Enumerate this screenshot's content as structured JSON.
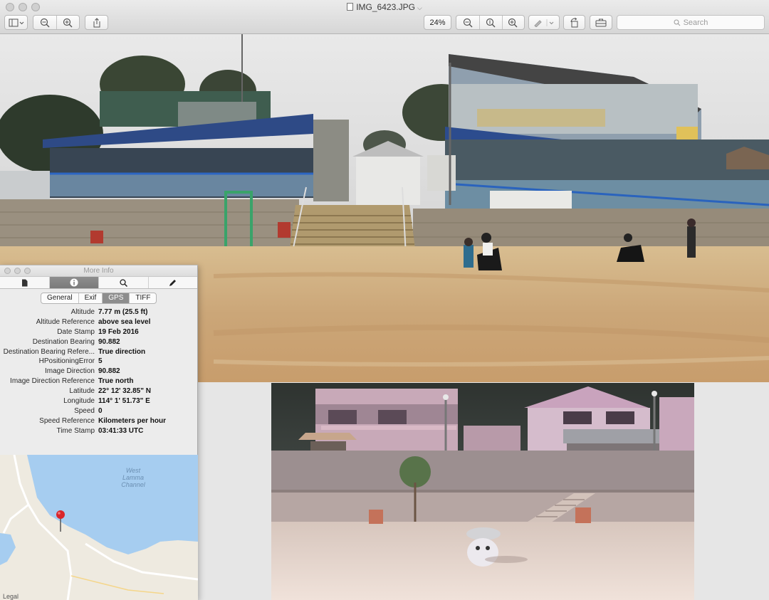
{
  "window": {
    "file_name": "IMG_6423.JPG",
    "zoom": "24%",
    "search_placeholder": "Search"
  },
  "toolbar_icons": [
    "sidebar-icon",
    "zoom-out-icon",
    "zoom-in-icon",
    "share-icon",
    "zoom-out-icon",
    "actual-size-icon",
    "zoom-in-icon",
    "markup-pen-icon",
    "rotate-icon",
    "toolbox-icon",
    "search-icon"
  ],
  "inspector": {
    "title": "More Info",
    "tabs": [
      "document-icon",
      "info-icon",
      "magnifier-icon",
      "pencil-icon"
    ],
    "segments": [
      "General",
      "Exif",
      "GPS",
      "TIFF"
    ],
    "active_segment": "GPS",
    "rows": [
      {
        "key": "Altitude",
        "value": "7.77 m (25.5 ft)"
      },
      {
        "key": "Altitude Reference",
        "value": "above sea level"
      },
      {
        "key": "Date Stamp",
        "value": "19 Feb 2016"
      },
      {
        "key": "Destination Bearing",
        "value": "90.882"
      },
      {
        "key": "Destination Bearing Refere...",
        "value": "True direction"
      },
      {
        "key": "HPositioningError",
        "value": "5"
      },
      {
        "key": "Image Direction",
        "value": "90.882"
      },
      {
        "key": "Image Direction Reference",
        "value": "True north"
      },
      {
        "key": "Latitude",
        "value": "22° 12' 32.85\" N"
      },
      {
        "key": "Longitude",
        "value": "114° 1' 51.73\" E"
      },
      {
        "key": "Speed",
        "value": "0"
      },
      {
        "key": "Speed Reference",
        "value": "Kilometers per hour"
      },
      {
        "key": "Time Stamp",
        "value": "03:41:33 UTC"
      }
    ],
    "map": {
      "water_label_1": "West",
      "water_label_2": "Lamma",
      "water_label_3": "Channel",
      "legal": "Legal"
    }
  },
  "colors": {
    "toolbar_top": "#ebebeb",
    "water": "#a6cdf0",
    "pin": "#d9262b"
  }
}
